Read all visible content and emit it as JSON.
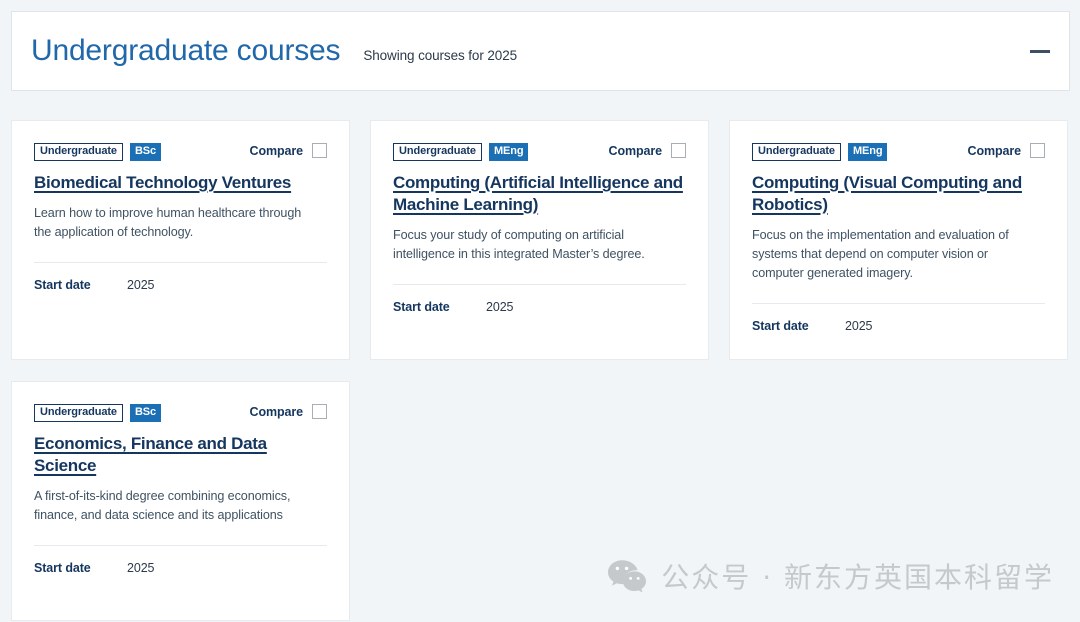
{
  "header": {
    "title": "Undergraduate courses",
    "subtitle": "Showing courses for 2025",
    "collapse_icon": "minus-icon"
  },
  "labels": {
    "compare": "Compare",
    "start_date": "Start date"
  },
  "colors": {
    "page_background": "#f2f5f8",
    "card_background": "#ffffff",
    "header_title": "#2168ab",
    "card_title": "#15365e",
    "degree_badge": "#1a6fb5",
    "body_text": "#3f5262",
    "card_border": "#e7ebee",
    "watermark": "#c6c9cc"
  },
  "cards": [
    {
      "level_tag": "Undergraduate",
      "degree_tag": "BSc",
      "compare_label": "Compare",
      "compare_checked": false,
      "title": "Biomedical Technology Ventures",
      "description": "Learn how to improve human healthcare through the application of technology.",
      "start_date_label": "Start date",
      "start_date_value": "2025"
    },
    {
      "level_tag": "Undergraduate",
      "degree_tag": "MEng",
      "compare_label": "Compare",
      "compare_checked": false,
      "title": "Computing (Artificial Intelligence and Machine Learning)",
      "description": "Focus your study of computing on artificial intelligence in this integrated Master’s degree.",
      "start_date_label": "Start date",
      "start_date_value": "2025"
    },
    {
      "level_tag": "Undergraduate",
      "degree_tag": "MEng",
      "compare_label": "Compare",
      "compare_checked": false,
      "title": "Computing (Visual Computing and Robotics)",
      "description": "Focus on the implementation and evaluation of systems that depend on computer vision or computer generated imagery.",
      "start_date_label": "Start date",
      "start_date_value": "2025"
    },
    {
      "level_tag": "Undergraduate",
      "degree_tag": "BSc",
      "compare_label": "Compare",
      "compare_checked": false,
      "title": "Economics, Finance and Data Science",
      "description": "A first-of-its-kind degree combining economics, finance, and data science and its applications",
      "start_date_label": "Start date",
      "start_date_value": "2025"
    }
  ],
  "watermark": {
    "icon": "wechat-icon",
    "text": "公众号 · 新东方英国本科留学"
  }
}
